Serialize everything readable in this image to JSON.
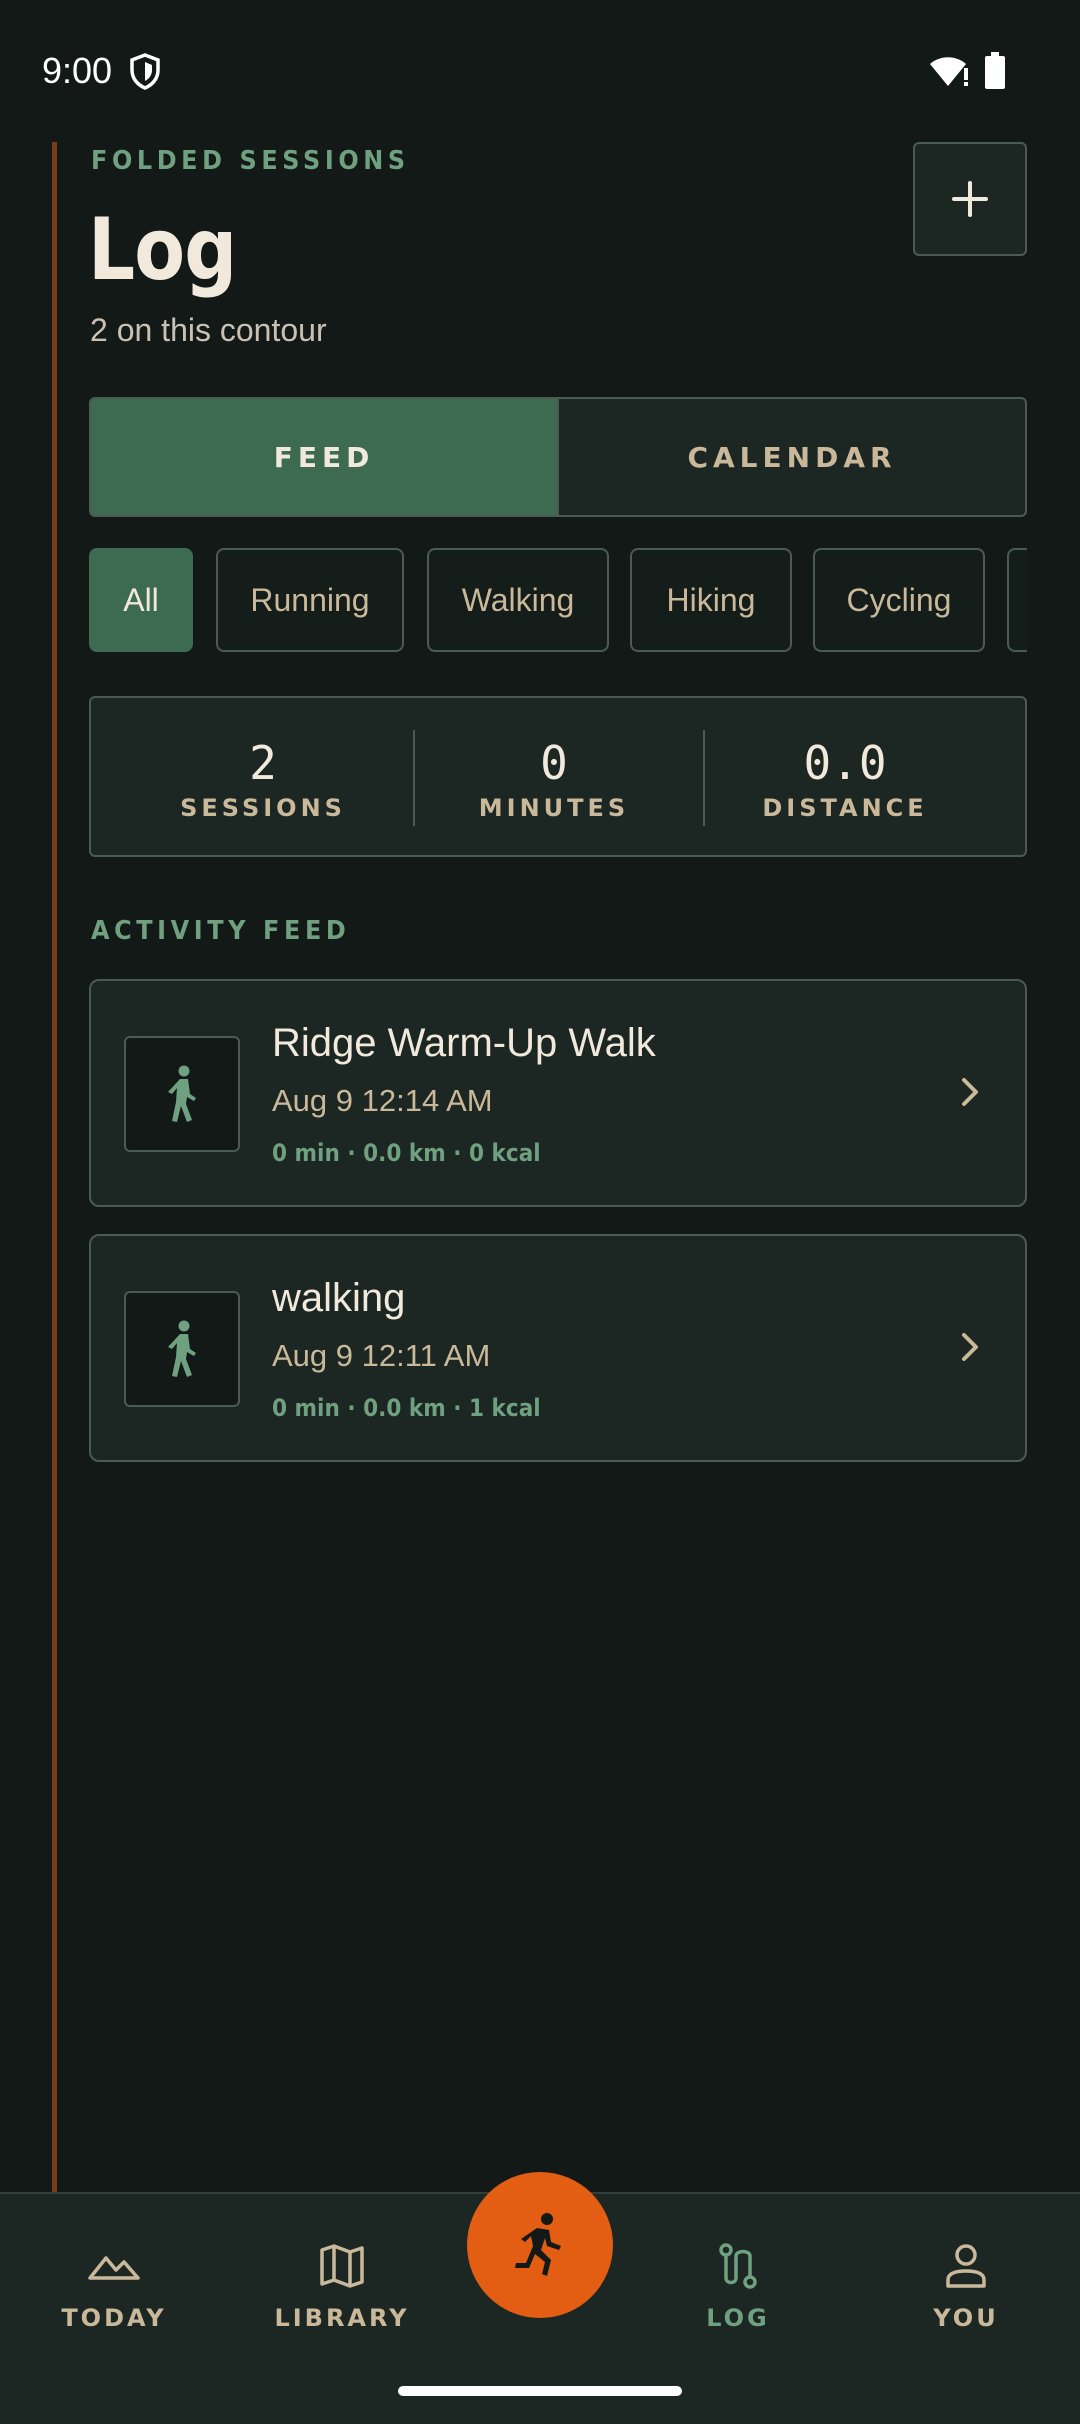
{
  "status_bar": {
    "time": "9:00"
  },
  "header": {
    "eyebrow": "FOLDED SESSIONS",
    "title": "Log",
    "subtitle": "2 on this contour",
    "add_label": "+"
  },
  "tabs": [
    {
      "label": "FEED",
      "active": true
    },
    {
      "label": "CALENDAR",
      "active": false
    }
  ],
  "filters": [
    {
      "label": "All",
      "active": true
    },
    {
      "label": "Running",
      "active": false
    },
    {
      "label": "Walking",
      "active": false
    },
    {
      "label": "Hiking",
      "active": false
    },
    {
      "label": "Cycling",
      "active": false
    }
  ],
  "stats": [
    {
      "value": "2",
      "label": "SESSIONS"
    },
    {
      "value": "0",
      "label": "MINUTES"
    },
    {
      "value": "0.0",
      "label": "DISTANCE"
    }
  ],
  "feed": {
    "section_label": "ACTIVITY FEED",
    "items": [
      {
        "title": "Ridge Warm-Up Walk",
        "date": "Aug 9 12:14 AM",
        "meta": "0 min · 0.0 km · 0 kcal",
        "icon": "walking-icon"
      },
      {
        "title": "walking",
        "date": "Aug 9 12:11 AM",
        "meta": "0 min · 0.0 km · 1 kcal",
        "icon": "walking-icon"
      }
    ]
  },
  "bottom_nav": [
    {
      "label": "TODAY",
      "icon": "mountain-icon",
      "active": false
    },
    {
      "label": "LIBRARY",
      "icon": "map-icon",
      "active": false
    },
    {
      "label": "LOG",
      "icon": "route-icon",
      "active": true
    },
    {
      "label": "YOU",
      "icon": "person-icon",
      "active": false
    }
  ],
  "fab": {
    "icon": "running-icon"
  },
  "colors": {
    "background": "#131917",
    "accent_green": "#3d6b52",
    "label_green": "#6fa07f",
    "fab_orange": "#e35d12",
    "rail": "#7a3d1a"
  }
}
